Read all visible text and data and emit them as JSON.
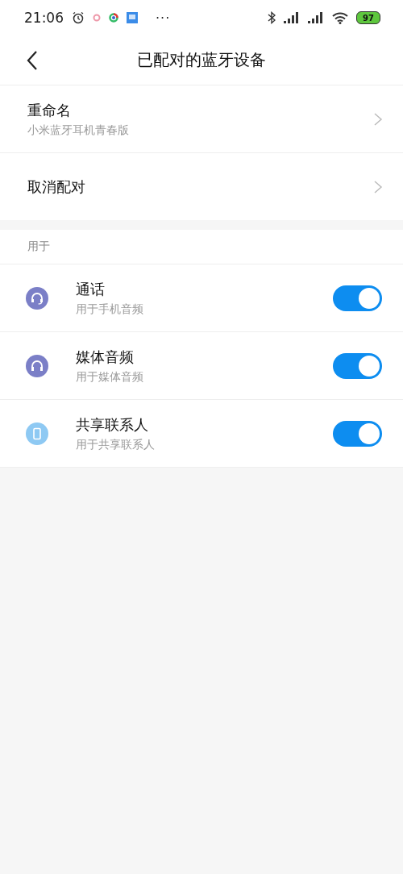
{
  "status_bar": {
    "time": "21:06",
    "more": "···",
    "battery": "97"
  },
  "header": {
    "title": "已配对的蓝牙设备"
  },
  "settings": [
    {
      "title": "重命名",
      "subtitle": "小米蓝牙耳机青春版"
    },
    {
      "title": "取消配对"
    }
  ],
  "section": {
    "label": "用于"
  },
  "profiles": [
    {
      "kind": "headset",
      "color": "#7b7fc7",
      "title": "通话",
      "subtitle": "用于手机音频",
      "on": true
    },
    {
      "kind": "headphones",
      "color": "#7b7fc7",
      "title": "媒体音频",
      "subtitle": "用于媒体音频",
      "on": true
    },
    {
      "kind": "phone",
      "color": "#8ec9f3",
      "title": "共享联系人",
      "subtitle": "用于共享联系人",
      "on": true
    }
  ]
}
